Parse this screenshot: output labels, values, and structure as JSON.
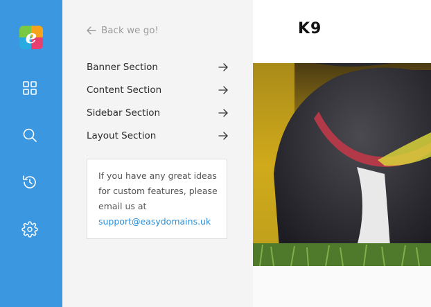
{
  "sidebar": {
    "logo_letter": "e",
    "icons": [
      "grid-icon",
      "search-icon",
      "history-icon",
      "gear-icon"
    ],
    "accent": "#3a97e0"
  },
  "panel": {
    "back_label": "Back we go!",
    "menu": [
      {
        "label": "Banner Section"
      },
      {
        "label": "Content Section"
      },
      {
        "label": "Sidebar Section"
      },
      {
        "label": "Layout Section"
      }
    ],
    "info": {
      "text": "If you have any great ideas for custom features, please email us at",
      "email": "support@easydomains.uk"
    }
  },
  "preview": {
    "brand": "K9",
    "hero_subject": "dog-photo"
  }
}
